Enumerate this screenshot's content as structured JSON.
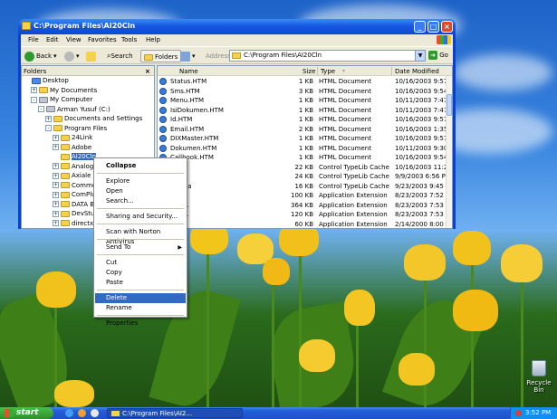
{
  "window": {
    "title": "C:\\Program Files\\AI20Cln",
    "minimize": "_",
    "maximize": "□",
    "close": "×"
  },
  "menubar": [
    "File",
    "Edit",
    "View",
    "Favorites",
    "Tools",
    "Help"
  ],
  "toolbar": {
    "back_label": "Back",
    "search_label": "Search",
    "folders_label": "Folders",
    "address_label": "Address",
    "address_value": "C:\\Program Files\\AI20Cln",
    "go_label": "Go"
  },
  "folders_pane": {
    "header": "Folders",
    "close": "×",
    "tree": [
      {
        "label": "Desktop",
        "expander": "",
        "level": 0
      },
      {
        "label": "My Documents",
        "expander": "+",
        "level": 1
      },
      {
        "label": "My Computer",
        "expander": "-",
        "level": 1
      },
      {
        "label": "Arman Yusuf (C:)",
        "expander": "-",
        "level": 2
      },
      {
        "label": "Documents and Settings",
        "expander": "+",
        "level": 3
      },
      {
        "label": "Program Files",
        "expander": "-",
        "level": 3
      },
      {
        "label": "24Link",
        "expander": "+",
        "level": 4
      },
      {
        "label": "Adobe",
        "expander": "+",
        "level": 4
      },
      {
        "label": "AI20Cln",
        "expander": "",
        "level": 4
      },
      {
        "label": "Analogi",
        "expander": "+",
        "level": 4
      },
      {
        "label": "Axiale",
        "expander": "+",
        "level": 4
      },
      {
        "label": "Commo",
        "expander": "+",
        "level": 4
      },
      {
        "label": "ComPlu",
        "expander": "+",
        "level": 4
      },
      {
        "label": "DATA B",
        "expander": "+",
        "level": 4
      },
      {
        "label": "DevStu",
        "expander": "+",
        "level": 4
      },
      {
        "label": "directx",
        "expander": "+",
        "level": 4
      }
    ]
  },
  "files_pane": {
    "columns": {
      "name": "Name",
      "size": "Size",
      "type": "Type",
      "date": "Date Modified"
    },
    "rows": [
      {
        "name": "Status.HTM",
        "size": "1 KB",
        "type": "HTML Document",
        "date": "10/16/2003 9:57 AM",
        "icon": "htm"
      },
      {
        "name": "Sms.HTM",
        "size": "3 KB",
        "type": "HTML Document",
        "date": "10/16/2003 9:54 AM",
        "icon": "htm"
      },
      {
        "name": "Menu.HTM",
        "size": "1 KB",
        "type": "HTML Document",
        "date": "10/11/2003 7:47 PM",
        "icon": "htm"
      },
      {
        "name": "IsiDokumen.HTM",
        "size": "1 KB",
        "type": "HTML Document",
        "date": "10/11/2003 7:47 PM",
        "icon": "htm"
      },
      {
        "name": "Id.HTM",
        "size": "1 KB",
        "type": "HTML Document",
        "date": "10/16/2003 9:57 AM",
        "icon": "htm"
      },
      {
        "name": "Email.HTM",
        "size": "2 KB",
        "type": "HTML Document",
        "date": "10/16/2003 1:35 PM",
        "icon": "htm"
      },
      {
        "name": "DIXMaster.HTM",
        "size": "1 KB",
        "type": "HTML Document",
        "date": "10/16/2003 9:57 AM",
        "icon": "htm"
      },
      {
        "name": "Dokumen.HTM",
        "size": "1 KB",
        "type": "HTML Document",
        "date": "10/11/2003 9:30 AM",
        "icon": "htm"
      },
      {
        "name": "Callbook.HTM",
        "size": "1 KB",
        "type": "HTML Document",
        "date": "10/16/2003 9:54 AM",
        "icon": "htm"
      },
      {
        "name": "oca",
        "size": "22 KB",
        "type": "Control TypeLib Cache",
        "date": "10/16/2003 11:23 AM",
        "icon": "oca"
      },
      {
        "name": "2.oca",
        "size": "24 KB",
        "type": "Control TypeLib Cache",
        "date": "9/9/2003 6:56 PM",
        "icon": "oca"
      },
      {
        "name": "32.oca",
        "size": "16 KB",
        "type": "Control TypeLib Cache",
        "date": "9/23/2003 9:45 PM",
        "icon": "oca"
      },
      {
        "name": "DLL",
        "size": "100 KB",
        "type": "Application Extension",
        "date": "8/23/2003 7:52 AM",
        "icon": "dll"
      },
      {
        "name": "2.DLL",
        "size": "364 KB",
        "type": "Application Extension",
        "date": "8/23/2003 7:53 AM",
        "icon": "dll"
      },
      {
        "name": "3.DLL",
        "size": "120 KB",
        "type": "Application Extension",
        "date": "8/23/2003 7:53 AM",
        "icon": "dll"
      },
      {
        "name": "LL",
        "size": "60 KB",
        "type": "Application Extension",
        "date": "2/14/2000 8:00 PM",
        "icon": "dll"
      }
    ]
  },
  "context_menu": {
    "items": [
      {
        "label": "Collapse",
        "bold": true,
        "highlight": false,
        "submenu": false
      },
      {
        "sep": true
      },
      {
        "label": "Explore",
        "bold": false,
        "highlight": false,
        "submenu": false
      },
      {
        "label": "Open",
        "bold": false,
        "highlight": false,
        "submenu": false
      },
      {
        "label": "Search...",
        "bold": false,
        "highlight": false,
        "submenu": false
      },
      {
        "sep": true
      },
      {
        "label": "Sharing and Security...",
        "bold": false,
        "highlight": false,
        "submenu": false
      },
      {
        "sep": true
      },
      {
        "label": "Scan with Norton AntiVirus",
        "bold": false,
        "highlight": false,
        "submenu": false
      },
      {
        "sep": true
      },
      {
        "label": "Send To",
        "bold": false,
        "highlight": false,
        "submenu": true
      },
      {
        "sep": true
      },
      {
        "label": "Cut",
        "bold": false,
        "highlight": false,
        "submenu": false
      },
      {
        "label": "Copy",
        "bold": false,
        "highlight": false,
        "submenu": false
      },
      {
        "label": "Paste",
        "bold": false,
        "highlight": false,
        "submenu": false
      },
      {
        "sep": true
      },
      {
        "label": "Delete",
        "bold": false,
        "highlight": true,
        "submenu": false
      },
      {
        "label": "Rename",
        "bold": false,
        "highlight": false,
        "submenu": false
      },
      {
        "sep": true
      },
      {
        "label": "Properties",
        "bold": false,
        "highlight": false,
        "submenu": false
      }
    ]
  },
  "desktop": {
    "recycle_bin_label": "Recycle Bin"
  },
  "taskbar": {
    "start_label": "start",
    "task_label": "C:\\Program Files\\AI2...",
    "clock": "3:52 PM"
  }
}
